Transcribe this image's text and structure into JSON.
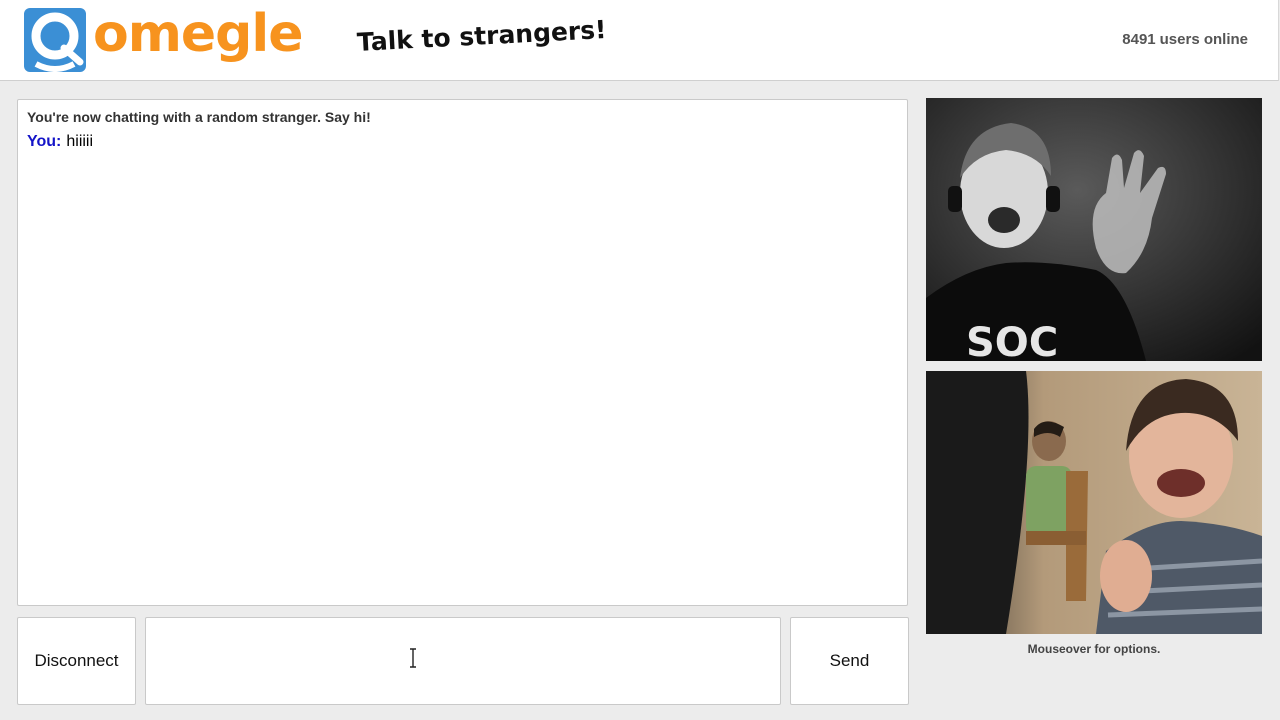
{
  "header": {
    "logo_text": "omegle",
    "tagline": "Talk to strangers!",
    "users_count": "8491",
    "users_label": "users online"
  },
  "chat": {
    "status_message": "You're now chatting with a random stranger. Say hi!",
    "messages": [
      {
        "sender": "You:",
        "text": "hiiiii"
      }
    ]
  },
  "controls": {
    "disconnect_label": "Disconnect",
    "send_label": "Send",
    "input_value": ""
  },
  "video": {
    "caption": "Mouseover for options."
  },
  "colors": {
    "brand_orange": "#f7931e",
    "brand_blue": "#3b8fd5",
    "you_label": "#1414c8"
  },
  "icons": [
    "omegle-logo-icon",
    "text-cursor-icon"
  ]
}
